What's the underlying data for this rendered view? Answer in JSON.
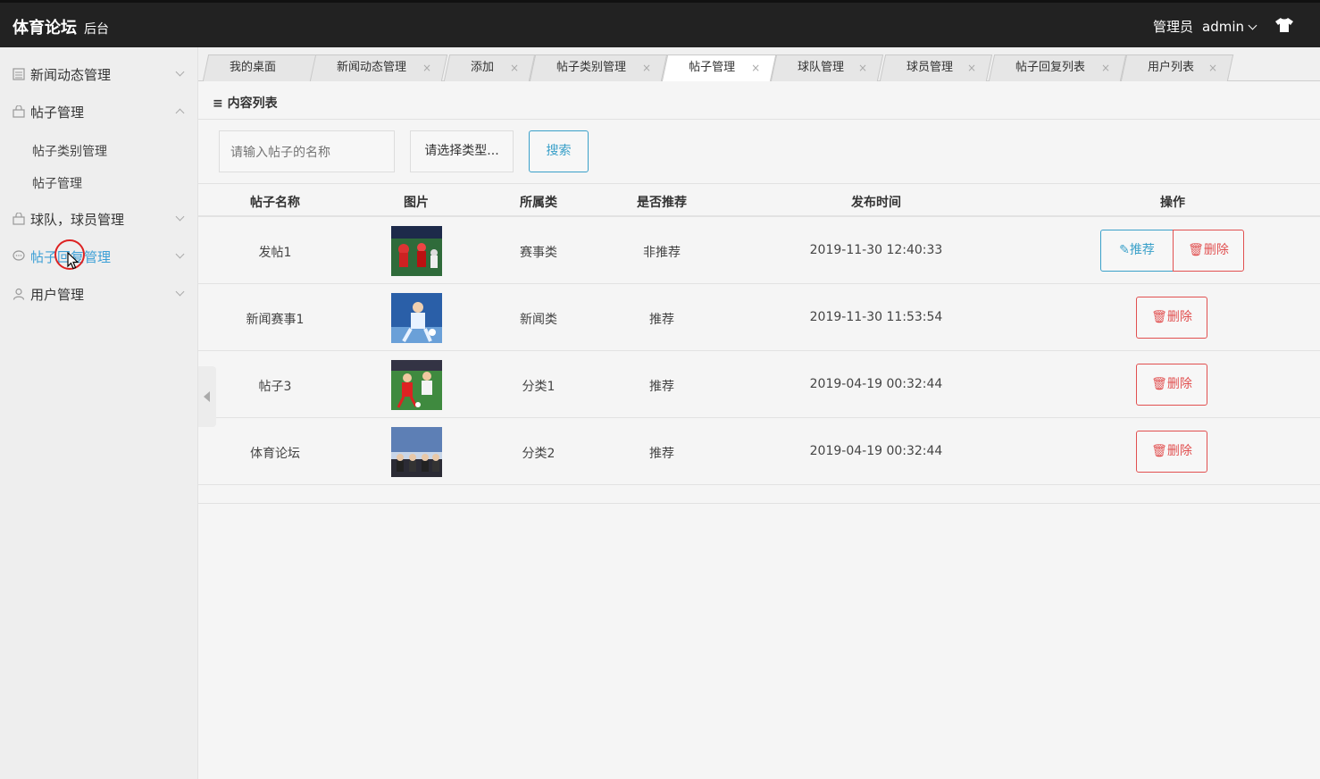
{
  "header": {
    "logo": "体育论坛",
    "logo_sub": "后台",
    "role": "管理员",
    "user": "admin"
  },
  "sidebar": {
    "items": [
      {
        "label": "新闻动态管理"
      },
      {
        "label": "帖子管理"
      },
      {
        "label": "球队，球员管理"
      },
      {
        "label": "帖子回复管理"
      },
      {
        "label": "用户管理"
      }
    ],
    "subitems": [
      {
        "label": "帖子类别管理"
      },
      {
        "label": "帖子管理"
      }
    ]
  },
  "tabs": [
    {
      "label": "我的桌面"
    },
    {
      "label": "新闻动态管理"
    },
    {
      "label": "添加"
    },
    {
      "label": "帖子类别管理"
    },
    {
      "label": "帖子管理"
    },
    {
      "label": "球队管理"
    },
    {
      "label": "球员管理"
    },
    {
      "label": "帖子回复列表"
    },
    {
      "label": "用户列表"
    }
  ],
  "content": {
    "section_title": "内容列表",
    "search_placeholder": "请输入帖子的名称",
    "type_select": "请选择类型...",
    "search_button": "搜索"
  },
  "table": {
    "columns": [
      "帖子名称",
      "图片",
      "所属类",
      "是否推荐",
      "发布时间",
      "操作"
    ],
    "rows": [
      {
        "name": "发帖1",
        "category": "赛事类",
        "recommended": "非推荐",
        "time": "2019-11-30 12:40:33",
        "recommend_btn": "推荐",
        "delete_btn": "删除"
      },
      {
        "name": "新闻赛事1",
        "category": "新闻类",
        "recommended": "推荐",
        "time": "2019-11-30 11:53:54",
        "delete_btn": "删除"
      },
      {
        "name": "帖子3",
        "category": "分类1",
        "recommended": "推荐",
        "time": "2019-04-19 00:32:44",
        "delete_btn": "删除"
      },
      {
        "name": "体育论坛",
        "category": "分类2",
        "recommended": "推荐",
        "time": "2019-04-19 00:32:44",
        "delete_btn": "删除"
      }
    ]
  },
  "colors": {
    "topbar": "#222222",
    "accent": "#3aa0c9",
    "danger": "#e15050"
  }
}
